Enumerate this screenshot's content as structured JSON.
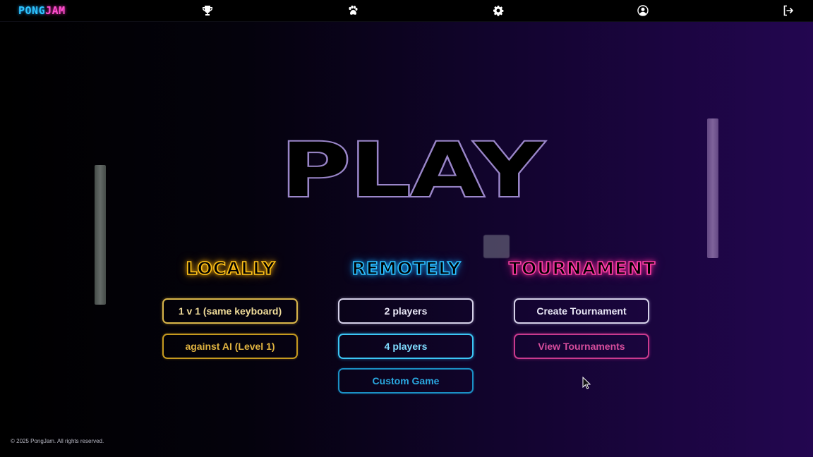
{
  "app": {
    "logo_part1": "PONG",
    "logo_part2": "JAM"
  },
  "nav": {
    "icons": [
      "trophy-icon",
      "paw-icon",
      "gear-icon",
      "user-icon",
      "logout-icon"
    ]
  },
  "main": {
    "title": "PLAY"
  },
  "sections": {
    "local": {
      "heading": "LOCALLY",
      "buttons": [
        "1 v 1 (same keyboard)",
        "against AI (Level 1)"
      ]
    },
    "remote": {
      "heading": "REMOTELY",
      "buttons": [
        "2 players",
        "4 players",
        "Custom Game"
      ]
    },
    "tournament": {
      "heading": "TOURNAMENT",
      "buttons": [
        "Create Tournament",
        "View Tournaments"
      ]
    }
  },
  "footer": {
    "text": "© 2025 PongJam. All rights reserved."
  },
  "colors": {
    "locally_accent": "#ffc21a",
    "remotely_accent": "#2ec0ff",
    "tournament_accent": "#ff3fa7",
    "title_outline": "#9a86c9"
  }
}
